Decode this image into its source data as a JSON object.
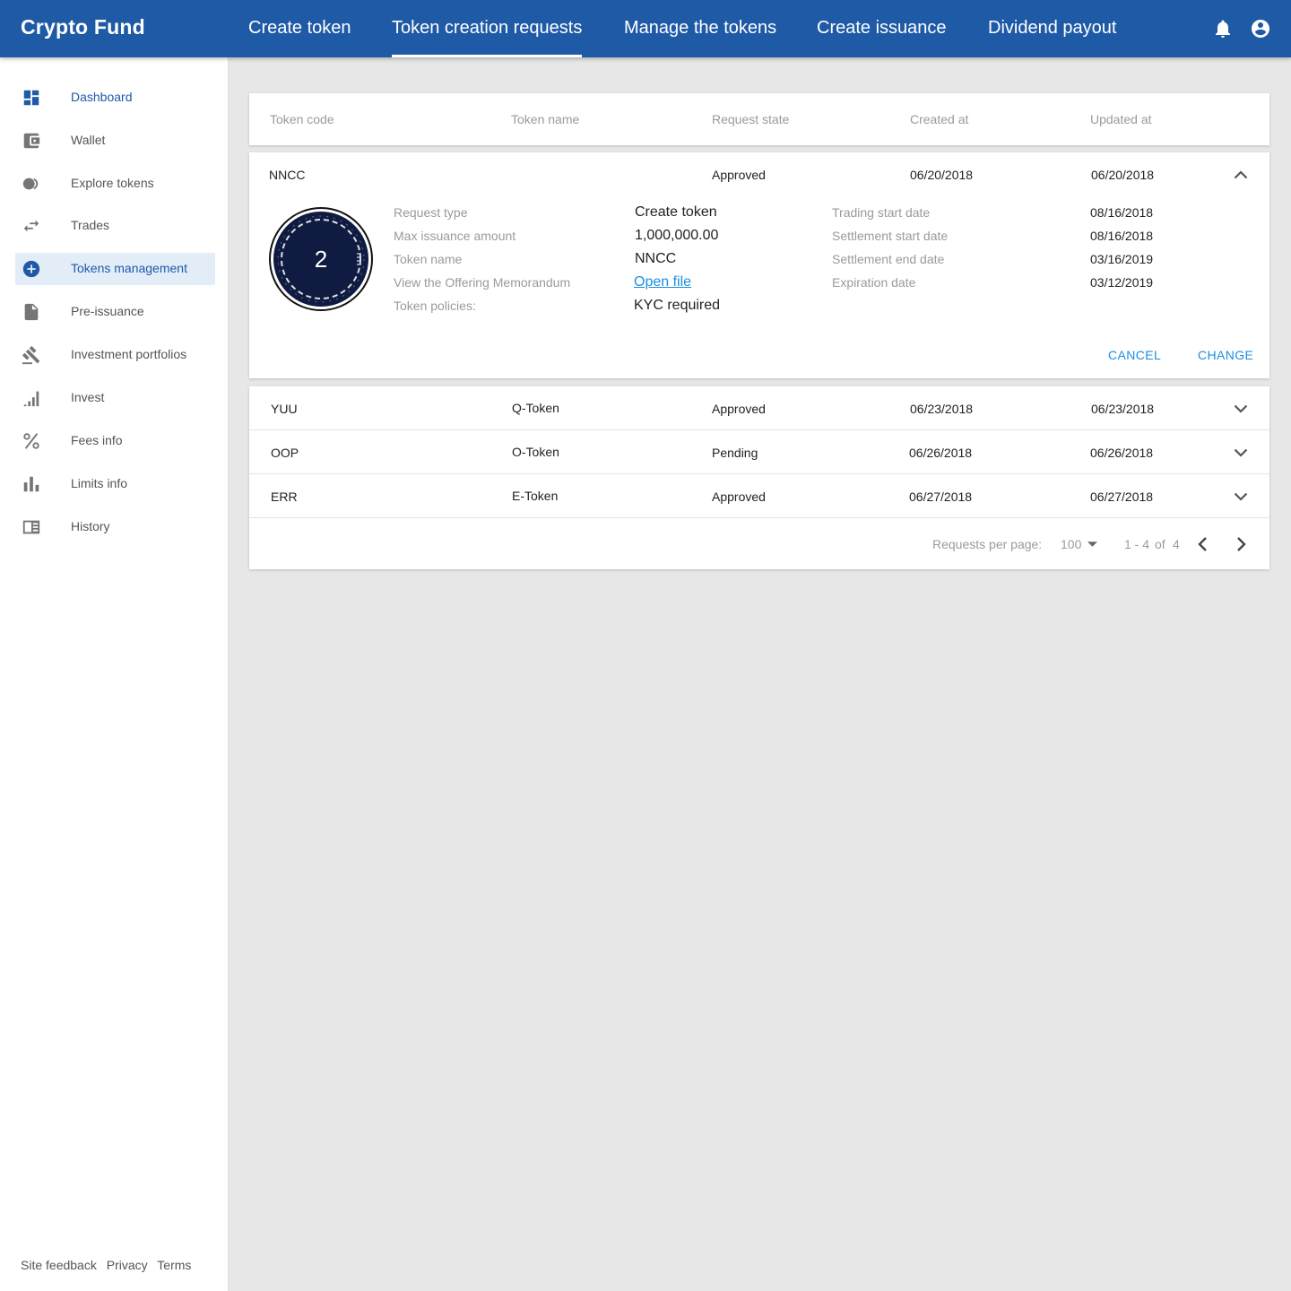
{
  "app": {
    "title": "Crypto Fund"
  },
  "tabs": [
    {
      "label": "Create token"
    },
    {
      "label": "Token creation requests"
    },
    {
      "label": "Manage the tokens"
    },
    {
      "label": "Create issuance"
    },
    {
      "label": "Dividend payout"
    }
  ],
  "header_icons": [
    "bell-icon",
    "account-icon"
  ],
  "sidebar": {
    "items": [
      {
        "label": "Dashboard",
        "icon": "dashboard-icon"
      },
      {
        "label": "Wallet",
        "icon": "wallet-icon"
      },
      {
        "label": "Explore tokens",
        "icon": "tokens-icon"
      },
      {
        "label": "Trades",
        "icon": "swap-icon"
      },
      {
        "label": "Tokens management",
        "icon": "add-circle-icon"
      },
      {
        "label": "Pre-issuance",
        "icon": "document-icon"
      },
      {
        "label": "Investment portfolios",
        "icon": "gavel-icon"
      },
      {
        "label": "Invest",
        "icon": "signal-bars-icon"
      },
      {
        "label": "Fees info",
        "icon": "percent-icon"
      },
      {
        "label": "Limits info",
        "icon": "bar-chart-icon"
      },
      {
        "label": "History",
        "icon": "history-icon"
      }
    ],
    "footer": [
      "Site feedback",
      "Privacy",
      "Terms"
    ]
  },
  "table": {
    "columns": [
      "Token code",
      "Token name",
      "Request state",
      "Created at",
      "Updated at"
    ],
    "expanded": {
      "code": "NNCC",
      "state": "Approved",
      "created": "06/20/2018",
      "updated": "06/20/2018",
      "logo_text": "2",
      "details_left": [
        {
          "label": "Request type",
          "value": "Create token"
        },
        {
          "label": "Max issuance amount",
          "value": "1,000,000.00"
        },
        {
          "label": "Token name",
          "value": "NNCC"
        },
        {
          "label": "View the Offering Memorandum",
          "value": "Open file"
        },
        {
          "label": "Token policies:",
          "value": "KYC required"
        }
      ],
      "details_right": [
        {
          "label": "Trading start date",
          "value": "08/16/2018"
        },
        {
          "label": "Settlement start date",
          "value": "08/16/2018"
        },
        {
          "label": "Settlement end date",
          "value": "03/16/2019"
        },
        {
          "label": "Expiration date",
          "value": "03/12/2019"
        }
      ],
      "actions": {
        "cancel": "CANCEL",
        "change": "CHANGE"
      }
    },
    "rows": [
      {
        "code": "YUU",
        "name": "Q-Token",
        "state": "Approved",
        "created": "06/23/2018",
        "updated": "06/23/2018"
      },
      {
        "code": "OOP",
        "name": "O-Token",
        "state": "Pending",
        "created": "06/26/2018",
        "updated": "06/26/2018"
      },
      {
        "code": "ERR",
        "name": "E-Token",
        "state": "Approved",
        "created": "06/27/2018",
        "updated": "06/27/2018"
      }
    ],
    "pagination": {
      "per_page_label": "Requests per page:",
      "per_page_value": "100",
      "range": "1 - 4",
      "of": "of",
      "total": "4"
    }
  },
  "colors": {
    "primary": "#1f5aa6",
    "link": "#1b8ee0",
    "background": "#e7e7e7",
    "logo_bg": "#0f1b40"
  }
}
